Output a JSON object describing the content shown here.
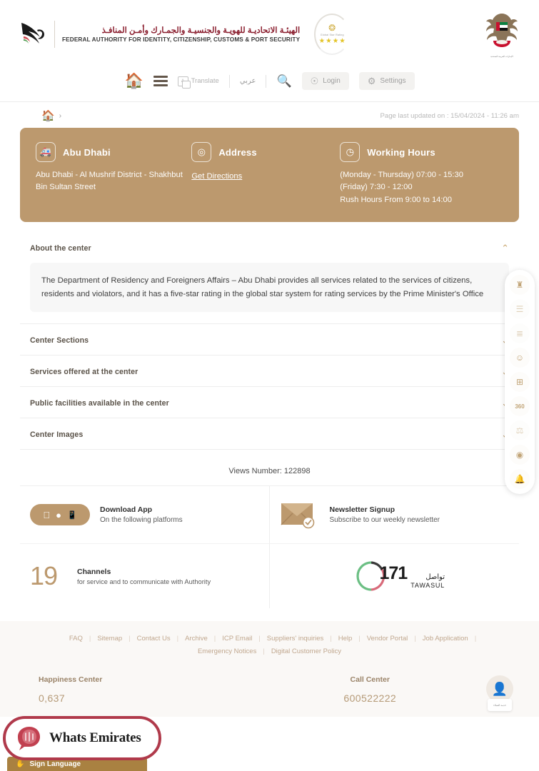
{
  "header": {
    "logo": {
      "arabic": "الهيئـة الاتحاديـة للهويـة والجنسيـة والجمـارك وأمـن المنافـذ",
      "english": "FEDERAL AUTHORITY FOR IDENTITY, CITIZENSHIP, CUSTOMS & PORT SECURITY",
      "falcon_icon": "falcon-logo-icon"
    },
    "star_badge": {
      "label": "Global Star Rating",
      "stars": 4,
      "star_glyph": "★",
      "badge_icon": "star-rating-badge-icon"
    },
    "uae_emblem": {
      "icon": "uae-national-emblem-icon",
      "caption": "الإمارات العربية المتحدة"
    }
  },
  "nav": {
    "home_icon": "home-icon",
    "menu_icon": "hamburger-menu-icon",
    "translate_label": "Translate",
    "translate_icon": "translate-icon",
    "arabic_label": "عربي",
    "search_icon": "search-icon",
    "login_label": "Login",
    "login_icon": "user-circle-icon",
    "settings_label": "Settings",
    "settings_icon": "gear-icon"
  },
  "breadcrumb": {
    "home_icon": "home-icon",
    "separator": "›",
    "last_updated": "Page last updated on : 15/04/2024 - 11:26 am"
  },
  "info_card": {
    "accent_color": "#bc996e",
    "columns": [
      {
        "icon": "building-icon",
        "title": "Abu Dhabi",
        "body": "Abu Dhabi - Al Mushrif District - Shakhbut Bin Sultan Street",
        "link": null
      },
      {
        "icon": "location-pin-icon",
        "title": "Address",
        "body": null,
        "link": "Get Directions"
      },
      {
        "icon": "clock-icon",
        "title": "Working Hours",
        "body": "(Monday - Thursday) 07:00 - 15:30\n(Friday) 7:30 - 12:00\nRush Hours From 9:00 to 14:00",
        "link": null
      }
    ]
  },
  "accordion": {
    "items": [
      {
        "label": "About the center",
        "expanded": true,
        "chevron": "⌃",
        "content": "The Department of Residency and Foreigners Affairs – Abu Dhabi provides all services related to the services of citizens, residents and violators, and it has a five-star rating in the global star system for rating services by the Prime Minister's Office"
      },
      {
        "label": "Center Sections",
        "expanded": false,
        "chevron": "⌄",
        "content": null
      },
      {
        "label": "Services offered at the center",
        "expanded": false,
        "chevron": "⌄",
        "content": null
      },
      {
        "label": "Public facilities available in the center",
        "expanded": false,
        "chevron": "⌄",
        "content": null
      },
      {
        "label": "Center Images",
        "expanded": false,
        "chevron": "⌄",
        "content": null
      }
    ]
  },
  "side_rail": {
    "buttons": [
      {
        "icon": "uae-emblem-icon",
        "glyph": "♜"
      },
      {
        "icon": "news-icon",
        "glyph": "☰"
      },
      {
        "icon": "document-list-icon",
        "glyph": "≣"
      },
      {
        "icon": "happiness-meter-icon",
        "glyph": "☺"
      },
      {
        "icon": "services-grid-icon",
        "glyph": "⊞"
      },
      {
        "icon": "360-tour-icon",
        "glyph": "360"
      },
      {
        "icon": "balance-scale-icon",
        "glyph": "⚖"
      },
      {
        "icon": "customer-pulse-icon",
        "glyph": "◉"
      },
      {
        "icon": "notification-bell-icon",
        "glyph": "ὑ4"
      }
    ]
  },
  "views": {
    "label": "Views Number: 122898"
  },
  "promo": {
    "download_app": {
      "title": "Download App",
      "subtitle": "On the following platforms",
      "icons": [
        "apple-icon",
        "android-icon",
        "phone-icon"
      ]
    },
    "newsletter": {
      "title": "Newsletter Signup",
      "subtitle": "Subscribe to our weekly newsletter",
      "icon": "envelope-check-icon"
    },
    "channels": {
      "number": "19",
      "title": "Channels",
      "subtitle": "for service and to communicate with Authority"
    },
    "tawasul": {
      "number": "171",
      "arabic": "تواصل",
      "latin": "TAWASUL",
      "icon": "tawasul-logo-icon"
    }
  },
  "footer": {
    "links": [
      "FAQ",
      "Sitemap",
      "Contact Us",
      "Archive",
      "ICP Email",
      "Suppliers' inquiries",
      "Help",
      "Vendor Portal",
      "Job Application",
      "Emergency Notices",
      "Digital Customer Policy"
    ],
    "separator": "|",
    "bottom": {
      "happiness": {
        "title": "Happiness Center",
        "value": "0,637"
      },
      "call_center": {
        "title": "Call Center",
        "value": "600522222"
      },
      "avatar": {
        "icon": "customer-avatar-icon",
        "card_text": "خدمة العملاء"
      }
    },
    "sign_language": {
      "label": "Sign Language",
      "icon": "sign-language-icon"
    }
  },
  "watermark": {
    "text": "Whats Emirates",
    "icon": "whats-emirates-logo-icon",
    "border_color": "#b03a4b"
  }
}
